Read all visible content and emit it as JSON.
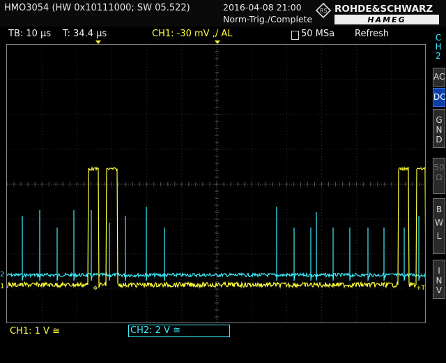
{
  "header": {
    "model_info": "HMO3054 (HW 0x10111000; SW 05.522)",
    "datetime": "2016-04-08 21:00",
    "trigger_status": "Norm-Trig./Complete",
    "brand_top": "ROHDE&SCHWARZ",
    "brand_bottom": "HAMEG"
  },
  "status": {
    "timebase": "TB: 10 µs",
    "trigger_time": "T: 34.4 µs",
    "ch1_trigger": "CH1: -30 mV ,/ AL",
    "sample_rate": "50 MSa",
    "acquisition_mode": "Refresh"
  },
  "side_menu": {
    "channel": [
      "C",
      "H",
      "2"
    ],
    "coupling_ac": "AC",
    "coupling_dc": "DC",
    "gnd": [
      "G",
      "N",
      "D"
    ],
    "impedance": [
      "50",
      "Ω"
    ],
    "bwl": [
      "B",
      "W",
      "L"
    ],
    "inv": [
      "I",
      "N",
      "V"
    ],
    "active": "DC"
  },
  "footer": {
    "ch1": "CH1: 1 V ≅",
    "ch2": "CH2: 2 V ≅"
  },
  "markers": {
    "ch2_ground": "2",
    "ch1_ground": "1",
    "trigger_right": "+T"
  },
  "colors": {
    "ch1": "#ffff3c",
    "ch2": "#3ff0ff",
    "grid": "#3a3a3a",
    "active_button": "#0b3ea8"
  }
}
